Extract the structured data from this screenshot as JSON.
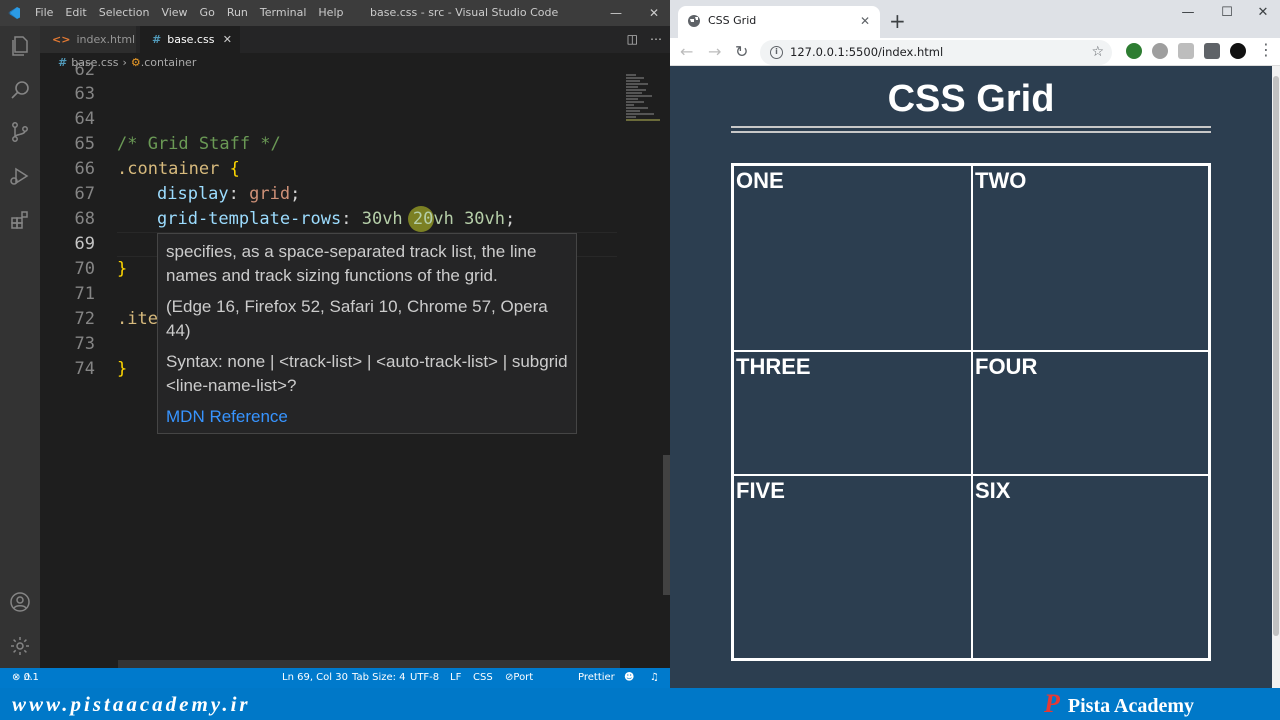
{
  "vscode": {
    "menu": [
      "File",
      "Edit",
      "Selection",
      "View",
      "Go",
      "Run",
      "Terminal",
      "Help"
    ],
    "window_title": "base.css - src - Visual Studio Code",
    "tabs": [
      {
        "label": "index.html",
        "active": false
      },
      {
        "label": "base.css",
        "active": true
      }
    ],
    "breadcrumb": {
      "file": "base.css",
      "symbol": ".container"
    },
    "line_numbers": [
      "62",
      "63",
      "64",
      "65",
      "66",
      "67",
      "68",
      "69",
      "70",
      "71",
      "72",
      "73",
      "74"
    ],
    "code": {
      "comment": "/* Grid Staff */",
      "selector": ".container",
      "open_brace": "{",
      "prop1": "display",
      "val1": "grid",
      "prop2": "grid-template-rows",
      "val2": "30vh 20vh 30vh",
      "close_brace": "}",
      "selector2": ".ite",
      "close_brace2": "}"
    },
    "hover": {
      "description": "specifies, as a space-separated track list, the line names and track sizing functions of the grid.",
      "compat": "(Edge 16, Firefox 52, Safari 10, Chrome 57, Opera 44)",
      "syntax": "Syntax: none | <track-list> | <auto-track-list> | subgrid <line-name-list>?",
      "link": "MDN Reference"
    },
    "status": {
      "errors": "0",
      "warnings": "1",
      "position": "Ln 69, Col 30",
      "tab_size": "Tab Size: 4",
      "encoding": "UTF-8",
      "eol": "LF",
      "language": "CSS",
      "port": "Port : 5500",
      "formatter": "Prettier"
    }
  },
  "browser": {
    "tab_title": "CSS Grid",
    "url": "127.0.0.1:5500/index.html",
    "page": {
      "heading": "CSS Grid",
      "cells": [
        "ONE",
        "TWO",
        "THREE",
        "FOUR",
        "FIVE",
        "SIX"
      ]
    }
  },
  "footer": {
    "site": "www.pistaacademy.ir",
    "brand_letter": "P",
    "brand": "Pista Academy"
  },
  "colors": {
    "vscode_accent": "#007acc",
    "page_background": "#2c3e50",
    "footer": "#0078c8"
  }
}
